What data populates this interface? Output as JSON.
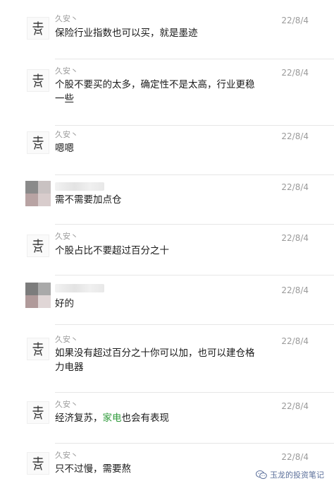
{
  "messages": [
    {
      "name": "久安丶",
      "date": "22/8/4",
      "text": "保险行业指数也可以买，就是墨迹"
    },
    {
      "name": "久安丶",
      "date": "22/8/4",
      "text": "个股不要买的太多，确定性不是太高，行业更稳一些"
    },
    {
      "name": "久安丶",
      "date": "22/8/4",
      "text": "嗯嗯"
    },
    {
      "name": "",
      "date": "22/8/4",
      "text": "需不需要加点仓"
    },
    {
      "name": "久安丶",
      "date": "22/8/4",
      "text": "个股占比不要超过百分之十"
    },
    {
      "name": "",
      "date": "22/8/4",
      "text": "好的"
    },
    {
      "name": "久安丶",
      "date": "22/8/4",
      "text": "如果没有超过百分之十你可以加，也可以建仓格力电器"
    },
    {
      "name": "久安丶",
      "date": "22/8/4",
      "text_before": "经济复苏，",
      "text_highlight": "家电",
      "text_after": "也会有表现"
    },
    {
      "name": "久安丶",
      "date": "22/8/4",
      "text": "只不过慢，需要熬"
    }
  ],
  "watermark": {
    "text": "玉龙的投资笔记",
    "icon": "wechat-icon"
  },
  "colors": {
    "highlight": "#2e9a3a",
    "meta": "#9a9a9a",
    "separator": "#e6e6e6"
  }
}
